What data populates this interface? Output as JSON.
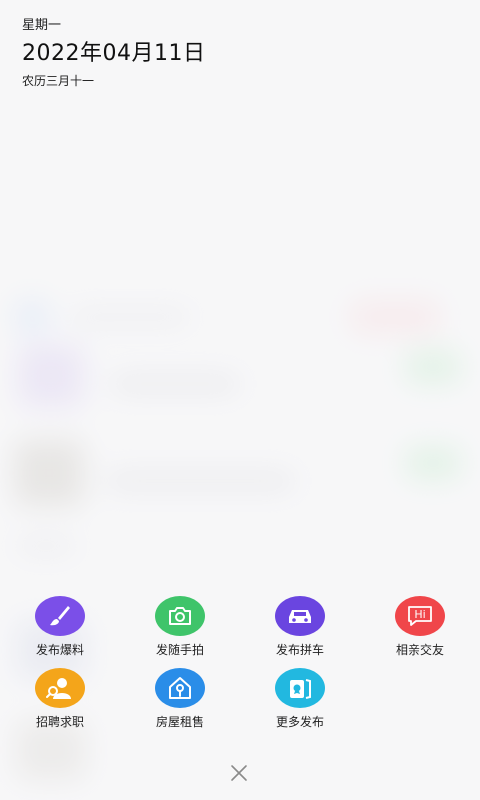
{
  "header": {
    "weekday": "星期一",
    "date": "2022年04月11日",
    "lunar": "农历三月十一"
  },
  "publish_menu": {
    "items": [
      {
        "id": "baoliao",
        "label": "发布爆料",
        "icon": "brush-icon",
        "color": "#7b4fe8"
      },
      {
        "id": "shoupai",
        "label": "发随手拍",
        "icon": "camera-icon",
        "color": "#3fc46a"
      },
      {
        "id": "pinche",
        "label": "发布拼车",
        "icon": "car-icon",
        "color": "#6a45e0"
      },
      {
        "id": "jiaoyou",
        "label": "相亲交友",
        "icon": "hi-bubble-icon",
        "color": "#f0464a"
      },
      {
        "id": "qiuzhi",
        "label": "招聘求职",
        "icon": "person-search-icon",
        "color": "#f4a51a"
      },
      {
        "id": "zushou",
        "label": "房屋租售",
        "icon": "house-key-icon",
        "color": "#2a8de8"
      },
      {
        "id": "more",
        "label": "更多发布",
        "icon": "cards-icon",
        "color": "#22b8e0"
      }
    ],
    "hi_text": "Hi"
  },
  "close_icon": "close-icon"
}
